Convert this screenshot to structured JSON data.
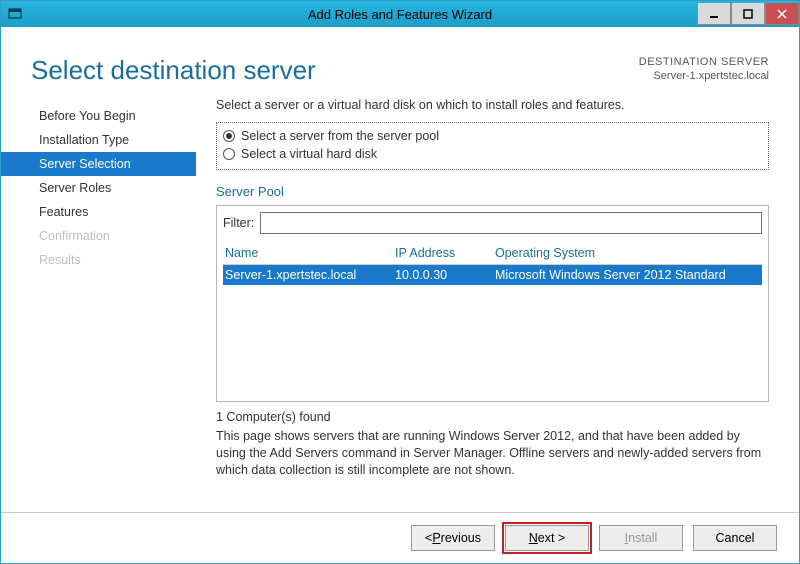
{
  "titlebar": {
    "title": "Add Roles and Features Wizard"
  },
  "header": {
    "page_title": "Select destination server",
    "dest_label": "DESTINATION SERVER",
    "dest_value": "Server-1.xpertstec.local"
  },
  "sidebar": {
    "steps": [
      {
        "label": "Before You Begin",
        "state": "normal"
      },
      {
        "label": "Installation Type",
        "state": "normal"
      },
      {
        "label": "Server Selection",
        "state": "active"
      },
      {
        "label": "Server Roles",
        "state": "normal"
      },
      {
        "label": "Features",
        "state": "normal"
      },
      {
        "label": "Confirmation",
        "state": "disabled"
      },
      {
        "label": "Results",
        "state": "disabled"
      }
    ]
  },
  "main": {
    "intro": "Select a server or a virtual hard disk on which to install roles and features.",
    "radio1": "Select a server from the server pool",
    "radio2": "Select a virtual hard disk",
    "pool_label": "Server Pool",
    "filter_label": "Filter:",
    "columns": {
      "name": "Name",
      "ip": "IP Address",
      "os": "Operating System"
    },
    "rows": [
      {
        "name": "Server-1.xpertstec.local",
        "ip": "10.0.0.30",
        "os": "Microsoft Windows Server 2012 Standard",
        "selected": true
      }
    ],
    "count": "1 Computer(s) found",
    "hint": "This page shows servers that are running Windows Server 2012, and that have been added by using the Add Servers command in Server Manager. Offline servers and newly-added servers from which data collection is still incomplete are not shown."
  },
  "buttons": {
    "previous_prefix": "< ",
    "previous_u": "P",
    "previous_rest": "revious",
    "next_u": "N",
    "next_rest": "ext >",
    "install_u": "I",
    "install_rest": "nstall",
    "cancel": "Cancel"
  }
}
